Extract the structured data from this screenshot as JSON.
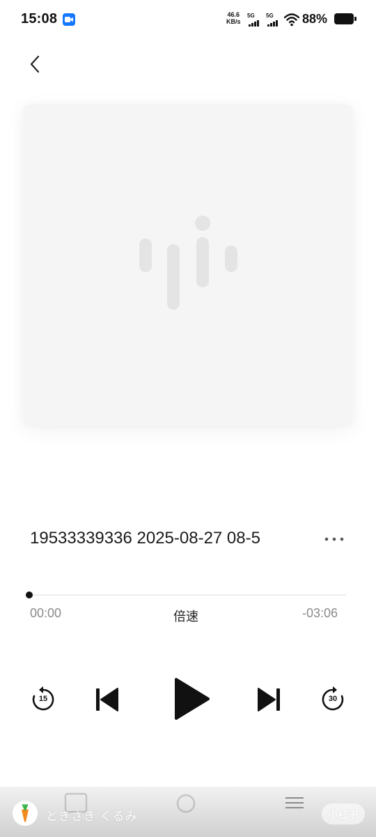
{
  "status_bar": {
    "time": "15:08",
    "net_speed_value": "46.6",
    "net_speed_unit": "KB/s",
    "sim1_tag": "5G",
    "sim2_tag": "5G",
    "battery": "88%"
  },
  "player": {
    "title": "19533339336 2025-08-27 08-5",
    "elapsed": "00:00",
    "speed_label": "倍速",
    "remaining": "-03:06",
    "progress": 0.0,
    "rewind_seconds": "15",
    "forward_seconds": "30"
  },
  "overlay": {
    "username": "ときさき くるみ",
    "brand": "小红书"
  },
  "icons": {
    "back": "back-chevron-icon",
    "more": "more-dots-icon",
    "cover": "audio-wave-logo-icon",
    "rewind": "rewind-15-icon",
    "prev": "skip-previous-icon",
    "play": "play-icon",
    "next": "skip-next-icon",
    "forward": "forward-30-icon",
    "menu": "menu-icon"
  }
}
